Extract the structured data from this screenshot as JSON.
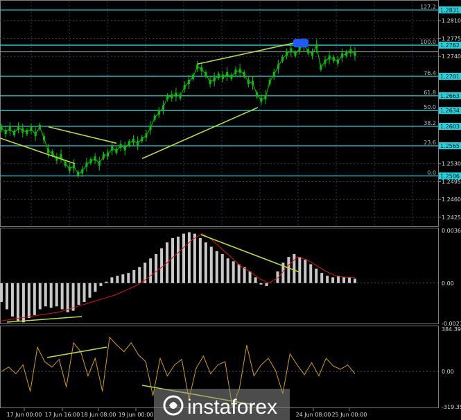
{
  "chart_data": [
    {
      "type": "line",
      "panel": "price",
      "grid": true,
      "ylim": [
        1.241,
        1.2845
      ],
      "y_ticks": [
        "1.2810",
        "1.2775",
        "1.2740",
        "1.2530",
        "1.2495",
        "1.2460",
        "1.2425"
      ],
      "fib_levels": [
        {
          "pct": "127.2",
          "price": "1.2831"
        },
        {
          "pct": "100.0",
          "price": "1.2762"
        },
        {
          "pct": "76.4",
          "price": "1.2701"
        },
        {
          "pct": "61.8",
          "price": "1.2663"
        },
        {
          "pct": "50.0",
          "price": "1.2634"
        },
        {
          "pct": "38.2",
          "price": "1.2603"
        },
        {
          "pct": "23.6",
          "price": "1.2565"
        },
        {
          "pct": "0.0",
          "price": "1.2506"
        }
      ],
      "current_price": "1.2749",
      "series": [
        {
          "color": "#00c800",
          "values": [
            1.26,
            1.2592,
            1.2598,
            1.259,
            1.26,
            1.2595,
            1.2592,
            1.2598,
            1.2588,
            1.2602,
            1.258,
            1.2555,
            1.255,
            1.254,
            1.2545,
            1.253,
            1.252,
            1.2525,
            1.251,
            1.2515,
            1.2528,
            1.2535,
            1.254,
            1.253,
            1.2545,
            1.2548,
            1.256,
            1.2555,
            1.2565,
            1.256,
            1.257,
            1.2575,
            1.257,
            1.2578,
            1.2585,
            1.26,
            1.262,
            1.263,
            1.264,
            1.266,
            1.2662,
            1.2665,
            1.2662,
            1.268,
            1.269,
            1.27,
            1.272,
            1.2715,
            1.2705,
            1.269,
            1.2695,
            1.2702,
            1.27,
            1.2705,
            1.27,
            1.271,
            1.2712,
            1.2705,
            1.269,
            1.2688,
            1.2665,
            1.2655,
            1.266,
            1.269,
            1.2705,
            1.272,
            1.2735,
            1.2745,
            1.2752,
            1.2745,
            1.2755,
            1.2762,
            1.275,
            1.2745,
            1.276,
            1.2718,
            1.273,
            1.2738,
            1.2735,
            1.273,
            1.2742,
            1.2745,
            1.275,
            1.2745
          ]
        }
      ]
    },
    {
      "type": "bar",
      "panel": "oscillator",
      "ylim": [
        -0.00278,
        0.00362
      ],
      "y_ticks": [
        "0.00362",
        "0.00",
        "-0.00278"
      ],
      "series": [
        {
          "color": "#c8c8c8",
          "values": [
            -0.0013,
            -0.0018,
            -0.0023,
            -0.0026,
            -0.0027,
            -0.0024,
            -0.0022,
            -0.0018,
            -0.0016,
            -0.0017,
            -0.0016,
            -0.0018,
            -0.002,
            -0.0019,
            -0.0015,
            -0.0013,
            -0.001,
            -0.0006,
            -0.0002,
            0.0001,
            0.0004,
            0.0005,
            0.0006,
            0.0007,
            0.0009,
            0.0011,
            0.0014,
            0.0017,
            0.002,
            0.0024,
            0.0028,
            0.0031,
            0.0032,
            0.0034,
            0.0035,
            0.0034,
            0.0031,
            0.0028,
            0.0025,
            0.0022,
            0.002,
            0.0017,
            0.0015,
            0.0013,
            0.0011,
            0.0008,
            0.0004,
            -0.0001,
            -0.0002,
            0.0,
            0.0008,
            0.0014,
            0.0018,
            0.002,
            0.0018,
            0.0016,
            0.0013,
            0.001,
            0.0007,
            0.0005,
            0.0004,
            0.0005,
            0.0004,
            0.0004,
            0.0003
          ]
        },
        {
          "color": "#e01010",
          "values": [
            -0.0026,
            -0.0025,
            -0.0024,
            -0.0023,
            -0.0022,
            -0.0021,
            -0.002,
            -0.0018,
            -0.0016,
            -0.0014,
            -0.0012,
            -0.001,
            -0.0008,
            -0.0005,
            -0.0002,
            0.0002,
            0.0007,
            0.0012,
            0.0018,
            0.0024,
            0.003,
            0.0034,
            0.003,
            0.0024,
            0.0018,
            0.0012,
            0.0008,
            0.0003,
            0.0,
            0.0004,
            0.0012,
            0.0018,
            0.0016,
            0.0012,
            0.0008,
            0.0005,
            0.0004,
            0.0004
          ]
        }
      ]
    },
    {
      "type": "line",
      "panel": "cci",
      "ylim": [
        -319.3579,
        384.3979
      ],
      "y_ticks": [
        "384.3979",
        "0.00",
        "-319.3579"
      ],
      "series": [
        {
          "color": "#d4a000",
          "values": [
            0,
            40,
            -20,
            60,
            -180,
            220,
            90,
            40,
            110,
            -140,
            260,
            180,
            -40,
            120,
            -180,
            310,
            240,
            180,
            260,
            150,
            90,
            -220,
            120,
            -40,
            60,
            110,
            -250,
            30,
            140,
            -20,
            60,
            90,
            -320,
            -150,
            240,
            -40,
            60,
            120,
            10,
            -200,
            160,
            60,
            -30,
            80,
            -40,
            120,
            50,
            20,
            60,
            -20
          ]
        }
      ]
    }
  ],
  "time_labels": [
    "17 Jun 00:00",
    "17 Jun 16:00",
    "18 Jun 08:00",
    "19 Jun 00:00",
    "24 Jun 08:00",
    "25 Jun 00:00"
  ],
  "watermark": "instaforex"
}
